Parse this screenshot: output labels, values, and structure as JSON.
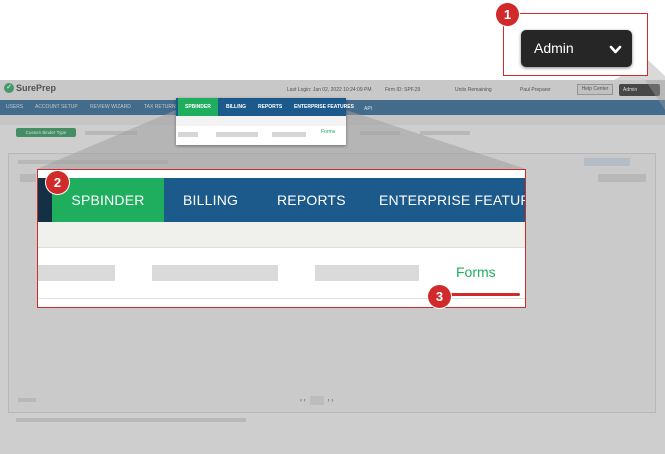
{
  "app": {
    "logo_text": "SurePrep",
    "last_login": "Last Login: Jan 02, 2022 10:24:09 PM",
    "firm_id": "Firm ID:   SPF.29",
    "units_remaining": "Units Remaining",
    "user_name": "Paul Preparer",
    "help_center": "Help Center",
    "admin_label": "Admin",
    "custom_binder_type": "Custom Binder Type",
    "nav": [
      "USERS",
      "ACCOUNT SETUP",
      "REVIEW WIZARD",
      "TAX RETURN",
      "SPBINDER",
      "BILLING",
      "REPORTS",
      "ENTERPRISE FEATURES",
      "API"
    ],
    "pager_prev": "‹ ‹",
    "pager_next": "› ›"
  },
  "mini_zoom": {
    "tabs": [
      "SPBINDER",
      "BILLING",
      "REPORTS",
      "ENTERPRISE FEATURES",
      "API"
    ],
    "forms": "Forms"
  },
  "zoom": {
    "tabs": [
      "SPBINDER",
      "BILLING",
      "REPORTS",
      "ENTERPRISE FEATUR"
    ],
    "forms": "Forms"
  },
  "admin_callout": {
    "label": "Admin",
    "chevron": "⌄"
  },
  "steps": [
    "1",
    "2",
    "3"
  ],
  "colors": {
    "nav_blue": "#1d5a8c",
    "active_green": "#1fae5e",
    "callout_red": "#d12a2a"
  }
}
